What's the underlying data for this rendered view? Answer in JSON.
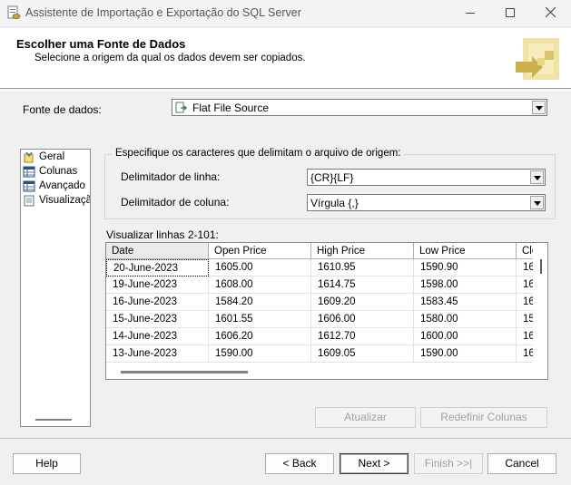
{
  "window": {
    "title": "Assistente de Importação e Exportação do SQL Server"
  },
  "header": {
    "title": "Escolher uma Fonte de Dados",
    "subtitle": "Selecione a origem da qual os dados devem ser copiados."
  },
  "data_source": {
    "label": "Fonte de dados:",
    "value": "Flat File Source"
  },
  "nav": {
    "items": [
      {
        "label": "Geral",
        "icon": "wizard-icon"
      },
      {
        "label": "Colunas",
        "icon": "table-icon"
      },
      {
        "label": "Avançado",
        "icon": "table-icon"
      },
      {
        "label": "Visualização",
        "icon": "preview-icon"
      }
    ]
  },
  "delimiters": {
    "group_title": "Especifique os caracteres que delimitam o arquivo de origem:",
    "row_label": "Delimitador de linha:",
    "row_value": "{CR}{LF}",
    "column_label": "Delimitador de coluna:",
    "column_value": "Vírgula {,}"
  },
  "preview": {
    "label": "Visualizar linhas 2-101:",
    "columns": [
      "Date",
      "Open Price",
      "High Price",
      "Low Price",
      "Clo"
    ],
    "rows": [
      [
        "20-June-2023",
        "1605.00",
        "1610.95",
        "1590.90",
        "16"
      ],
      [
        "19-June-2023",
        "1608.00",
        "1614.75",
        "1598.00",
        "16"
      ],
      [
        "16-June-2023",
        "1584.20",
        "1609.20",
        "1583.45",
        "16"
      ],
      [
        "15-June-2023",
        "1601.55",
        "1606.00",
        "1580.00",
        "15"
      ],
      [
        "14-June-2023",
        "1606.20",
        "1612.70",
        "1600.00",
        "16"
      ],
      [
        "13-June-2023",
        "1590.00",
        "1609.05",
        "1590.00",
        "16"
      ]
    ]
  },
  "actions": {
    "refresh": "Atualizar",
    "reset_columns": "Redefinir Colunas"
  },
  "footer": {
    "help": "Help",
    "back": "< Back",
    "next": "Next >",
    "finish": "Finish >>|",
    "cancel": "Cancel"
  }
}
